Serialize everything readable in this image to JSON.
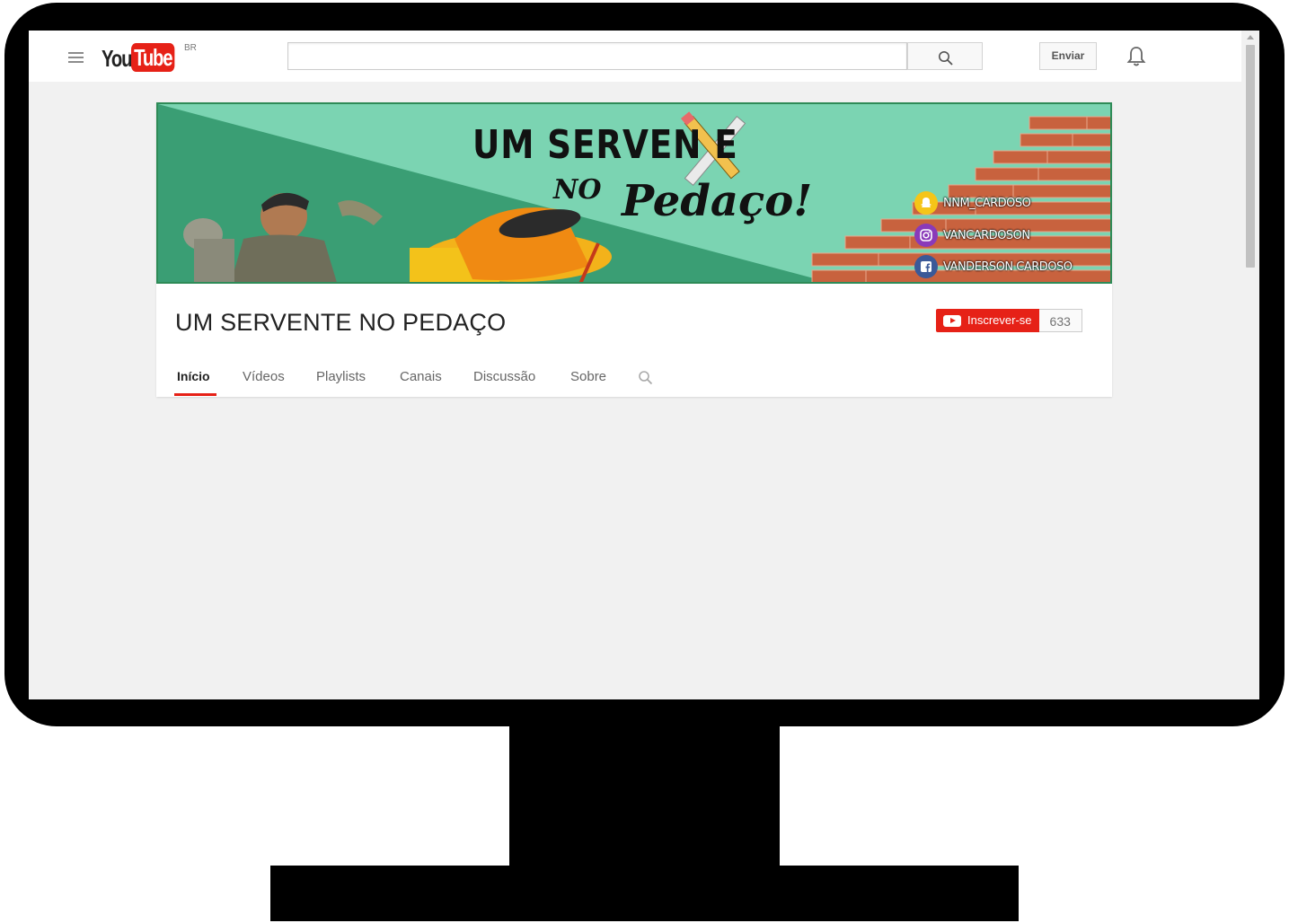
{
  "masthead": {
    "logo_you": "You",
    "logo_tube": "Tube",
    "region": "BR",
    "search_value": "",
    "upload_label": "Enviar"
  },
  "banner": {
    "title_line1": "UM SERVEN E",
    "title_no": "NO",
    "title_pedaco": "Pedaço!",
    "social": [
      {
        "network": "snapchat",
        "icon": "ghost-icon",
        "handle": "NNM_CARDOSO",
        "color": "#f5c518"
      },
      {
        "network": "instagram",
        "icon": "instagram-icon",
        "handle": "VANCARDOSON",
        "color": "#8a3ab9"
      },
      {
        "network": "facebook",
        "icon": "facebook-icon",
        "handle": "VANDERSON CARDOSO",
        "color": "#3b5998"
      }
    ]
  },
  "channel": {
    "name": "UM SERVENTE NO PEDAÇO",
    "subscribe_label": "Inscrever-se",
    "subscriber_count": "633"
  },
  "tabs": [
    {
      "label": "Início",
      "active": true
    },
    {
      "label": "Vídeos",
      "active": false
    },
    {
      "label": "Playlists",
      "active": false
    },
    {
      "label": "Canais",
      "active": false
    },
    {
      "label": "Discussão",
      "active": false
    },
    {
      "label": "Sobre",
      "active": false
    }
  ],
  "colors": {
    "brand_red": "#e62117",
    "banner_green_light": "#7bd4b2",
    "banner_green_dark": "#3a9e74",
    "brick": "#c8623e"
  }
}
